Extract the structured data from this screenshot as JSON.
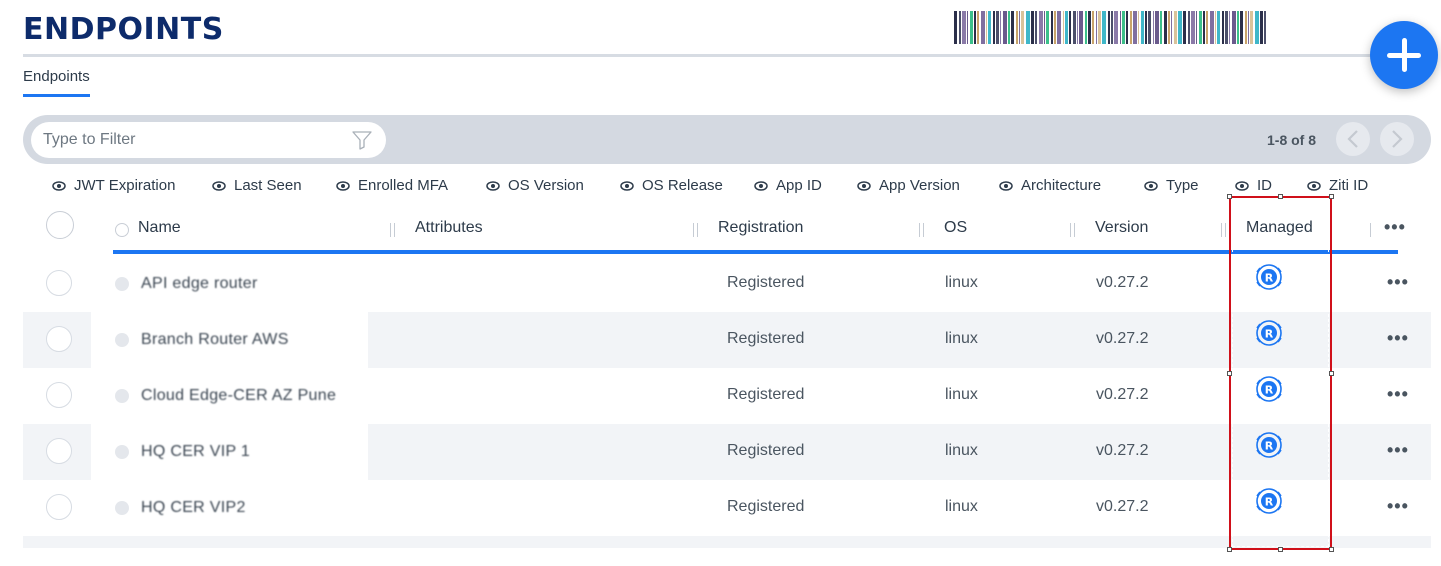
{
  "header": {
    "title": "ENDPOINTS",
    "add_button_icon": "plus-icon"
  },
  "tabs": [
    {
      "label": "Endpoints",
      "active": true
    }
  ],
  "filter": {
    "placeholder": "Type to Filter",
    "funnel_icon": "funnel-icon",
    "pagination": "1-8 of 8"
  },
  "column_toggles": [
    "JWT Expiration",
    "Last Seen",
    "Enrolled MFA",
    "OS Version",
    "OS Release",
    "App ID",
    "App Version",
    "Architecture",
    "Type",
    "ID",
    "Ziti ID"
  ],
  "table": {
    "headers": {
      "name": "Name",
      "attributes": "Attributes",
      "registration": "Registration",
      "os": "OS",
      "version": "Version",
      "managed": "Managed",
      "actions": "•••"
    },
    "rows": [
      {
        "name": "API edge router",
        "registration": "Registered",
        "os": "linux",
        "version": "v0.27.2",
        "managed_icon": "managed-router-icon",
        "actions": "•••"
      },
      {
        "name": "Branch Router AWS",
        "registration": "Registered",
        "os": "linux",
        "version": "v0.27.2",
        "managed_icon": "managed-router-icon",
        "actions": "•••"
      },
      {
        "name": "Cloud Edge-CER AZ Pune",
        "registration": "Registered",
        "os": "linux",
        "version": "v0.27.2",
        "managed_icon": "managed-router-icon",
        "actions": "•••"
      },
      {
        "name": "HQ CER VIP 1",
        "registration": "Registered",
        "os": "linux",
        "version": "v0.27.2",
        "managed_icon": "managed-router-icon",
        "actions": "•••"
      },
      {
        "name": "HQ CER VIP2",
        "registration": "Registered",
        "os": "linux",
        "version": "v0.27.2",
        "managed_icon": "managed-router-icon",
        "actions": "•••"
      }
    ]
  },
  "colors": {
    "accent": "#1c76f2",
    "title": "#0d2b6b",
    "highlight": "#d0101a"
  }
}
